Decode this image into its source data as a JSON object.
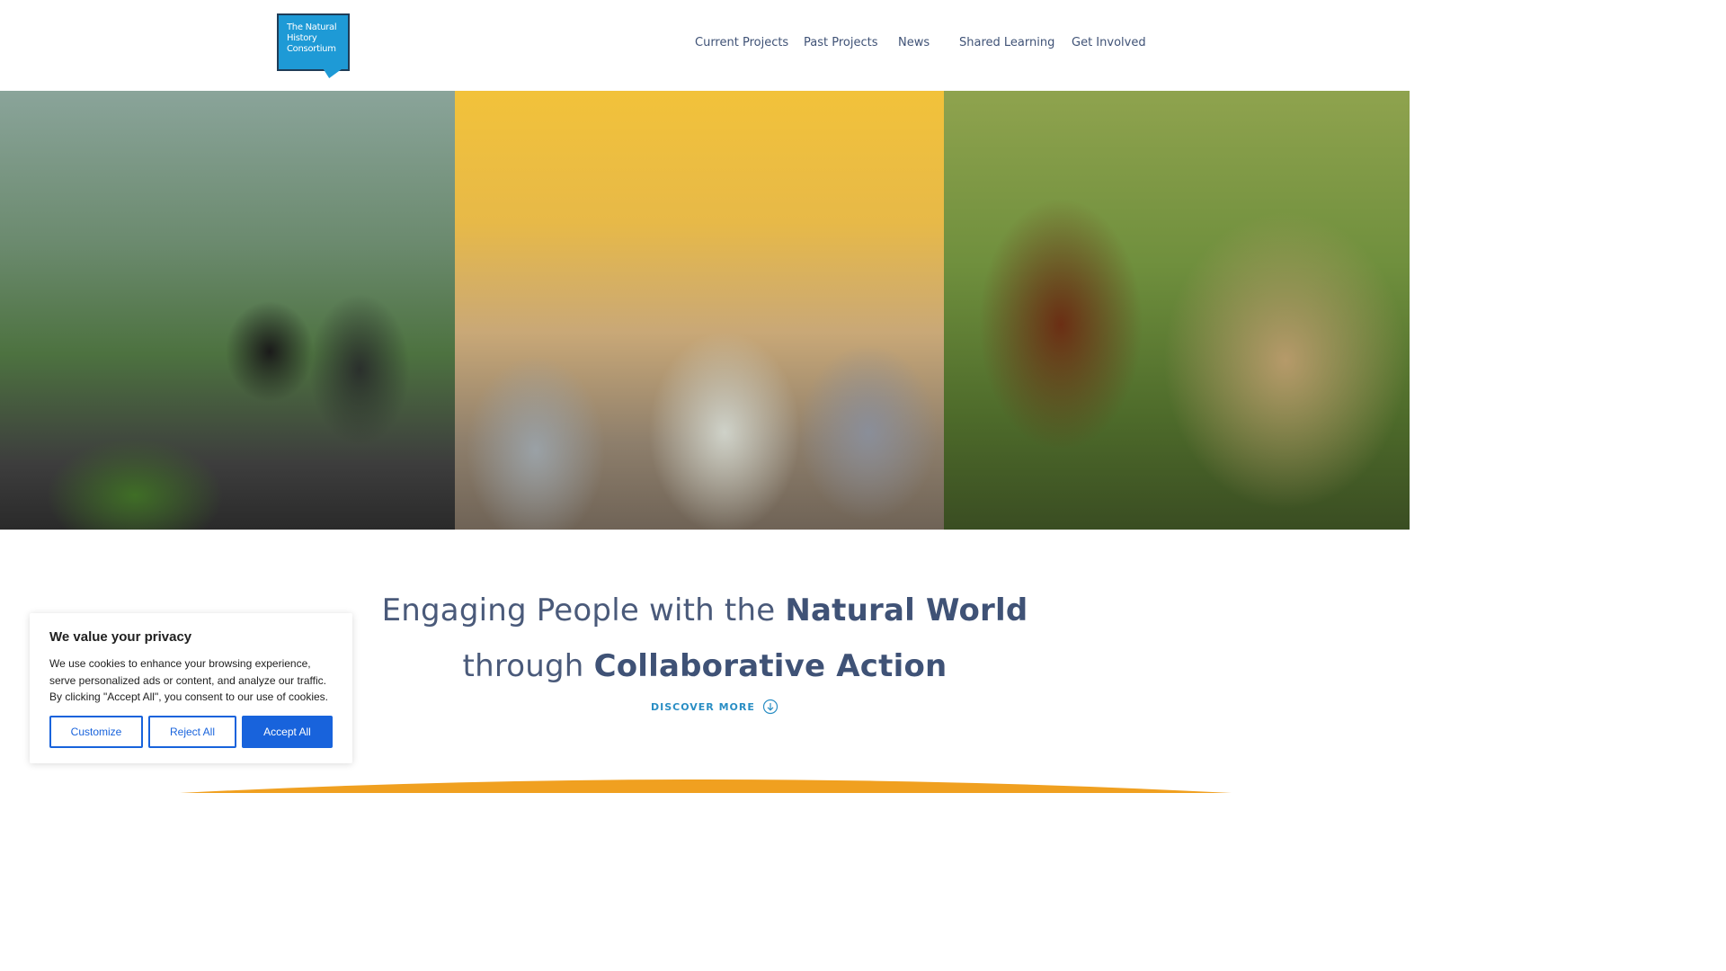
{
  "brand": {
    "logo_text": "The Natural History Consortium",
    "logo_color": "#1e9ad6"
  },
  "nav": {
    "items": [
      {
        "label": "Current Projects"
      },
      {
        "label": "Past Projects"
      },
      {
        "label": "News"
      },
      {
        "label": "Shared Learning"
      },
      {
        "label": "Get Involved"
      }
    ]
  },
  "hero": {
    "photos": [
      {
        "name": "family-planting-seedlings-photo"
      },
      {
        "name": "audience-seated-event-photo"
      },
      {
        "name": "woman-inspecting-bug-hotel-photo"
      }
    ]
  },
  "tagline": {
    "line1_light": "Engaging People with the ",
    "line1_bold": "Natural World",
    "line2_light": "through ",
    "line2_bold": "Collaborative Action"
  },
  "discover": {
    "label": "DISCOVER MORE",
    "icon": "arrow-down-circle-icon"
  },
  "cookie_banner": {
    "title": "We value your privacy",
    "text": "We use cookies to enhance your browsing experience, serve personalized ads or content, and analyze our traffic. By clicking \"Accept All\", you consent to our use of cookies.",
    "customize_label": "Customize",
    "reject_label": "Reject All",
    "accept_label": "Accept All",
    "accent_color": "#1863dc"
  },
  "colors": {
    "heading": "#4a5a7a",
    "link_blue": "#2a8ec4",
    "footer_orange": "#f0a020"
  }
}
